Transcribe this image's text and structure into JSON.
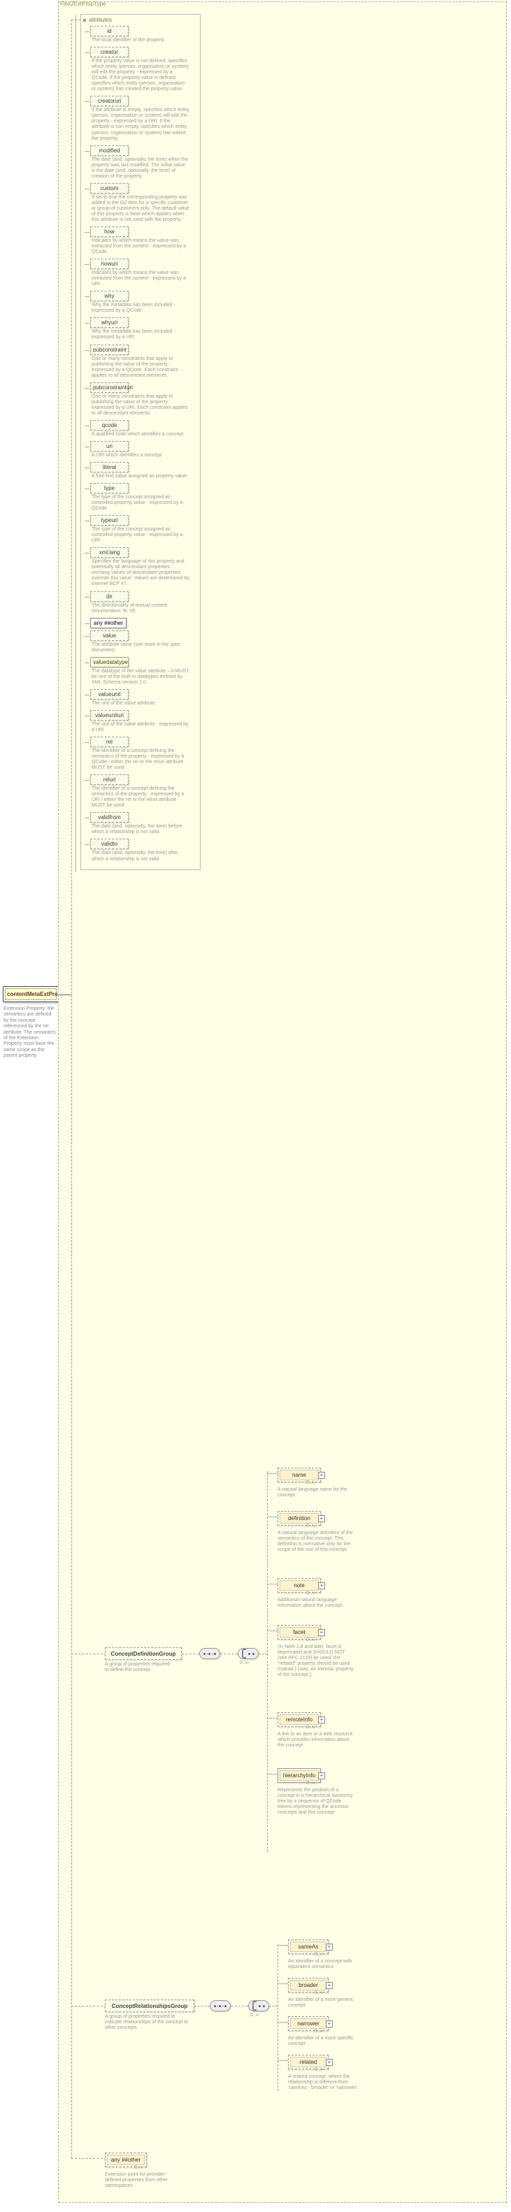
{
  "root": {
    "name": "contentMetaExtProperty",
    "desc": "Extension Property: the semantics are defined by the concept referenced by the rel attribute. The semantics of the Extension Property must have the same scope as the parent property."
  },
  "type_label": "Flex2ExtPropType",
  "attributes_label": "attributes",
  "attrs": [
    {
      "name": "id",
      "desc": "The local identifier of the property."
    },
    {
      "name": "creator",
      "desc": "If the property value is not defined, specifies which entity (person, organisation or system) will edit the property - expressed by a QCode. If the property value is defined, specifies which entity (person, organisation or system) has created the property value."
    },
    {
      "name": "creatoruri",
      "desc": "If the attribute is empty, specifies which entity (person, organisation or system) will edit the property - expressed by a URI. If the attribute is non-empty, specifies which entity (person, organisation or system) has edited the property."
    },
    {
      "name": "modified",
      "desc": "The date (and, optionally, the time) when the property was last modified. The initial value is the date (and, optionally, the time) of creation of the property."
    },
    {
      "name": "custom",
      "desc": "If set to true the corresponding property was added to the G2 Item for a specific customer or group of customers only. The default value of this property is false which applies when this attribute is not used with the property."
    },
    {
      "name": "how",
      "desc": "Indicates by which means the value was extracted from the content - expressed by a QCode"
    },
    {
      "name": "howuri",
      "desc": "Indicates by which means the value was extracted from the content - expressed by a URI"
    },
    {
      "name": "why",
      "desc": "Why the metadata has been included - expressed by a QCode"
    },
    {
      "name": "whyuri",
      "desc": "Why the metadata has been included - expressed by a URI"
    },
    {
      "name": "pubconstraint",
      "desc": "One or many constraints that apply to publishing the value of the property - expressed by a QCode. Each constraint applies to all descendant elements."
    },
    {
      "name": "pubconstrainturi",
      "desc": "One or many constraints that apply to publishing the value of the property - expressed by a URI. Each constraint applies to all descendant elements."
    },
    {
      "name": "qcode",
      "desc": "A qualified code which identifies a concept."
    },
    {
      "name": "uri",
      "desc": "A URI which identifies a concept."
    },
    {
      "name": "literal",
      "desc": "A free-text value assigned as property value."
    },
    {
      "name": "type",
      "desc": "The type of the concept assigned as controlled property value - expressed by a QCode"
    },
    {
      "name": "typeuri",
      "desc": "The type of the concept assigned as controlled property value - expressed by a URI"
    },
    {
      "name": "xml:lang",
      "desc": "Specifies the language of this property and potentially all descendant properties. xml:lang values of descendant properties override this value. Values are determined by Internet BCP 47."
    },
    {
      "name": "dir",
      "desc": "The directionality of textual content (enumeration: ltr, rtl)"
    },
    {
      "name": "any ##other",
      "any": true
    },
    {
      "name": "value",
      "desc": "The attribute value (see more in the spec document)"
    },
    {
      "name": "valuedatatype",
      "desc": "The datatype of the value attribute – it MUST be one of the built-in datatypes defined by XML Schema version 1.0.",
      "solid": true
    },
    {
      "name": "valueunit",
      "desc": "The unit of the value attribute."
    },
    {
      "name": "valueunituri",
      "desc": "The unit of the value attribute - expressed by a URI"
    },
    {
      "name": "rel",
      "desc": "The identifier of a concept defining the semantics of the property - expressed by a QCode / either the rel or the reluri attribute MUST be used"
    },
    {
      "name": "reluri",
      "desc": "The identifier of a concept defining the semantics of the property - expressed by a URI / either the rel or the reluri attribute MUST be used"
    },
    {
      "name": "validfrom",
      "desc": "The date (and, optionally, the time) before which a relationship is not valid."
    },
    {
      "name": "validto",
      "desc": "The date (and, optionally, the time) after which a relationship is not valid."
    }
  ],
  "group1": {
    "name": "ConceptDefinitionGroup",
    "desc": "A group of properties required to define the concept"
  },
  "group2": {
    "name": "ConceptRelationshipsGroup",
    "desc": "A group of properties required to indicate relationships of the concept to other concepts"
  },
  "any_other": {
    "name": "any ##other",
    "desc": "Extension point for provider-defined properties from other namespaces"
  },
  "leaves_def": [
    {
      "name": "name",
      "desc": "A natural language name for the concept."
    },
    {
      "name": "definition",
      "desc": "A natural language definition of the semantics of the concept. This definition is normative only for the scope of the use of this concept."
    },
    {
      "name": "note",
      "desc": "Additional natural language information about the concept."
    },
    {
      "name": "facet",
      "desc": "(In NAR 1.8 and later, facet is deprecated and SHOULD NOT (see RFC 2119) be used, the \"related\" property should be used instead.) (was: An intrinsic property of the concept.)"
    },
    {
      "name": "remoteInfo",
      "desc": "A link to an item or a web resource which provides information about the concept"
    },
    {
      "name": "hierarchyInfo",
      "desc": "Represents the position of a concept in a hierarchical taxonomy tree by a sequence of QCode tokens representing the ancestor concepts and this concept",
      "solid": true
    }
  ],
  "leaves_rel": [
    {
      "name": "sameAs",
      "desc": "An identifier of a concept with equivalent semantics"
    },
    {
      "name": "broader",
      "desc": "An identifier of a more generic concept."
    },
    {
      "name": "narrower",
      "desc": "An identifier of a more specific concept."
    },
    {
      "name": "related",
      "desc": "A related concept, where the relationship is different from 'sameAs', 'broader' or 'narrower'."
    }
  ],
  "cardinality": "0..∞"
}
